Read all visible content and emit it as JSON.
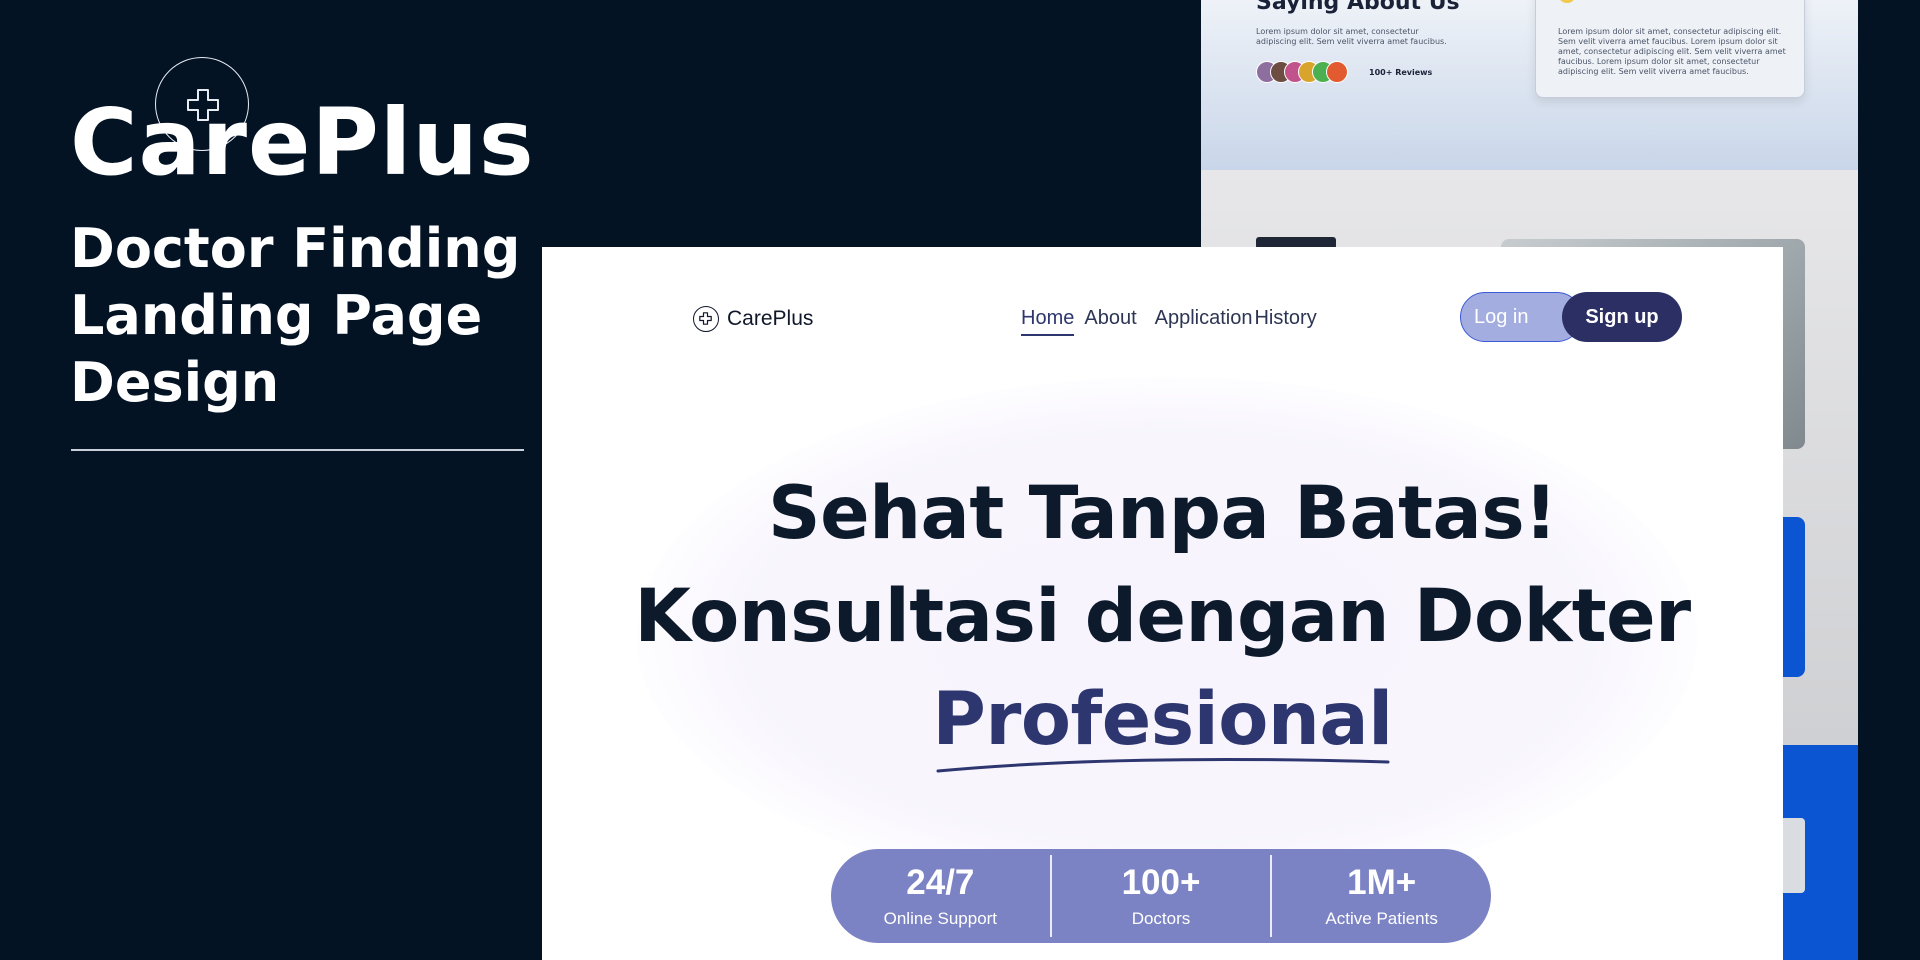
{
  "brand": {
    "title": "CarePlus",
    "subtitle_lines": [
      "Doctor Finding",
      "Landing Page",
      "Design"
    ]
  },
  "icons": {
    "brand_logo": "medical-cross-icon",
    "nav_logo": "medical-cross-icon"
  },
  "background_mockup": {
    "testimonials_title": "Saying About Us",
    "testimonials_text": "Lorem ipsum dolor sit amet, consectetur adipiscing elit. Sem velit viverra amet faucibus.",
    "reviews_count": "100+ Reviews",
    "card_text": "Lorem ipsum dolor sit amet, consectetur adipiscing elit. Sem velit viverra amet faucibus. Lorem ipsum dolor sit amet, consectetur adipiscing elit. Sem velit viverra amet faucibus. Lorem ipsum dolor sit amet, consectetur adipiscing elit. Sem velit viverra amet faucibus.",
    "avatar_colors": [
      "#8d6e9e",
      "#6d4c41",
      "#c2528b",
      "#d9a42b",
      "#4caf50",
      "#e25a2f"
    ]
  },
  "navbar": {
    "logo_text": "CarePlus",
    "links": [
      "Home",
      "About",
      "Application",
      "History"
    ],
    "active_link": "Home",
    "login_label": "Log in",
    "signup_label": "Sign up"
  },
  "hero": {
    "line1": "Sehat Tanpa Batas!",
    "line2": "Konsultasi dengan Dokter",
    "line3": "Profesional"
  },
  "stats": [
    {
      "value": "24/7",
      "label": "Online Support"
    },
    {
      "value": "100+",
      "label": "Doctors"
    },
    {
      "value": "1M+",
      "label": "Active Patients"
    }
  ],
  "colors": {
    "background": "#031324",
    "accent": "#2e3670",
    "stats_bg": "#7c83c4",
    "login_bg": "#a4ade0",
    "signup_bg": "#2c2f63",
    "bg_blue": "#0b55d3"
  }
}
